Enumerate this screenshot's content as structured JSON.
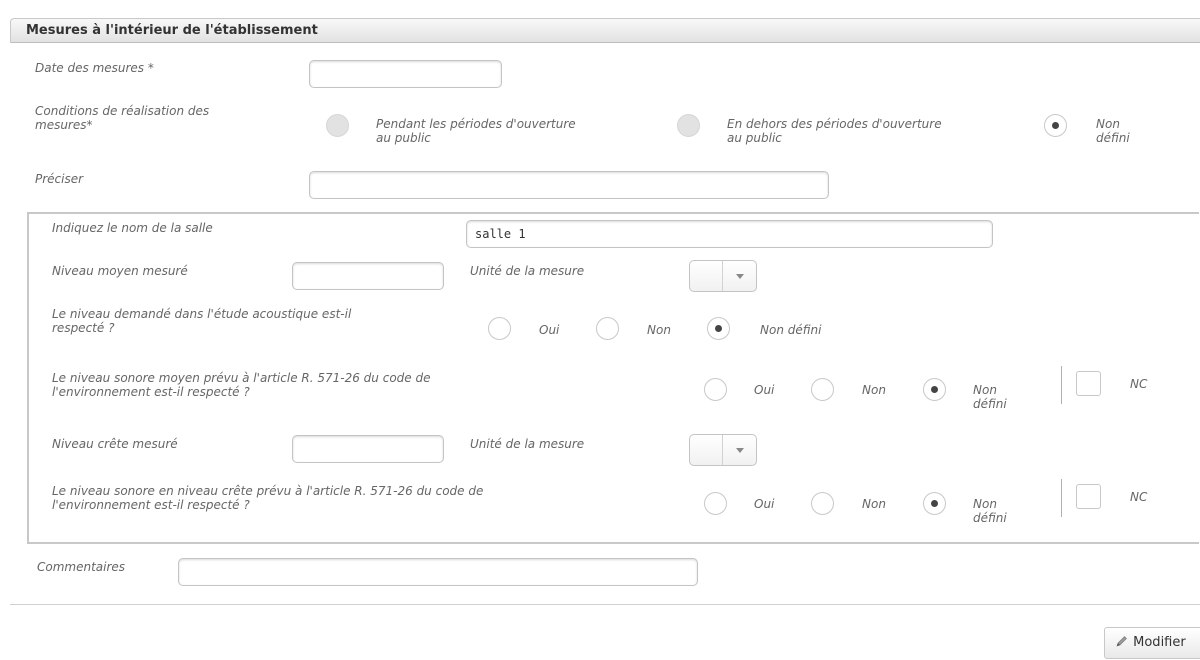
{
  "section": {
    "title": "Mesures à l'intérieur de l'établissement"
  },
  "date_field": {
    "label": "Date des mesures *",
    "value": ""
  },
  "conditions": {
    "label_line1": "Conditions de réalisation des",
    "label_line2": "mesures*",
    "options": [
      {
        "line1": "Pendant les périodes d'ouverture",
        "line2": "au public",
        "checked": false
      },
      {
        "line1": "En dehors des périodes d'ouverture",
        "line2": "au public",
        "checked": false
      },
      {
        "line1": "Non",
        "line2": "défini",
        "checked": true
      }
    ]
  },
  "preciser": {
    "label": "Préciser",
    "value": ""
  },
  "salle": {
    "name_label": "Indiquez le nom de la salle",
    "name_value": "salle 1",
    "niveau_moyen_label": "Niveau moyen mesuré",
    "niveau_moyen_value": "",
    "unite_label_1": "Unité de la mesure",
    "etude_question_line1": "Le niveau demandé dans l'étude acoustique est-il",
    "etude_question_line2": "respecté ?",
    "etude_options": {
      "oui": "Oui",
      "non": "Non",
      "non_defini": "Non défini",
      "selected": "Non défini"
    },
    "moyen_question_line1": "Le niveau sonore moyen prévu à l'article R. 571-26 du code de",
    "moyen_question_line2": "l'environnement est-il respecté ?",
    "moyen_options": {
      "oui": "Oui",
      "non": "Non",
      "non_defini_1": "Non",
      "non_defini_2": "défini",
      "selected": "Non défini"
    },
    "moyen_nc": "NC",
    "niveau_crete_label": "Niveau crête mesuré",
    "niveau_crete_value": "",
    "unite_label_2": "Unité de la mesure",
    "crete_question_line1": "Le niveau sonore en niveau crête prévu à l'article R. 571-26 du code de",
    "crete_question_line2": "l'environnement est-il respecté ?",
    "crete_options": {
      "oui": "Oui",
      "non": "Non",
      "non_defini_1": "Non",
      "non_defini_2": "défini",
      "selected": "Non défini"
    },
    "crete_nc": "NC"
  },
  "commentaires": {
    "label": "Commentaires",
    "value": ""
  },
  "actions": {
    "modifier_label": "Modifier",
    "modifier_icon": "pencil-icon"
  }
}
